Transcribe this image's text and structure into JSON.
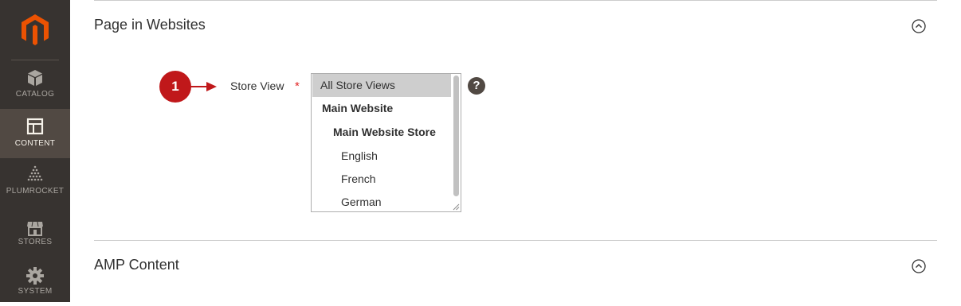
{
  "sidebar": {
    "items": [
      {
        "label": "CATALOG",
        "icon": "box-icon",
        "active": false
      },
      {
        "label": "CONTENT",
        "icon": "layout-icon",
        "active": true
      },
      {
        "label": "PLUMROCKET",
        "icon": "pyramid-icon",
        "active": false
      },
      {
        "label": "STORES",
        "icon": "storefront-icon",
        "active": false
      },
      {
        "label": "SYSTEM",
        "icon": "gear-icon",
        "active": false
      }
    ]
  },
  "sections": {
    "websites_title": "Page in Websites",
    "amp_title": "AMP Content"
  },
  "form": {
    "step_number": "1",
    "store_view_label": "Store View",
    "required_mark": "*",
    "help": "?",
    "options": [
      {
        "label": "All Store Views",
        "selected": true,
        "bold": false
      },
      {
        "label": "Main Website",
        "selected": false,
        "bold": true
      },
      {
        "label": "Main Website Store",
        "selected": false,
        "bold": true
      },
      {
        "label": "English",
        "selected": false,
        "bold": false
      },
      {
        "label": "French",
        "selected": false,
        "bold": false
      },
      {
        "label": "German",
        "selected": false,
        "bold": false
      }
    ]
  },
  "colors": {
    "sidebar_bg": "#373330",
    "sidebar_active": "#514943",
    "logo_orange": "#eb5202",
    "badge_red": "#c0181a",
    "required_red": "#e22626"
  }
}
